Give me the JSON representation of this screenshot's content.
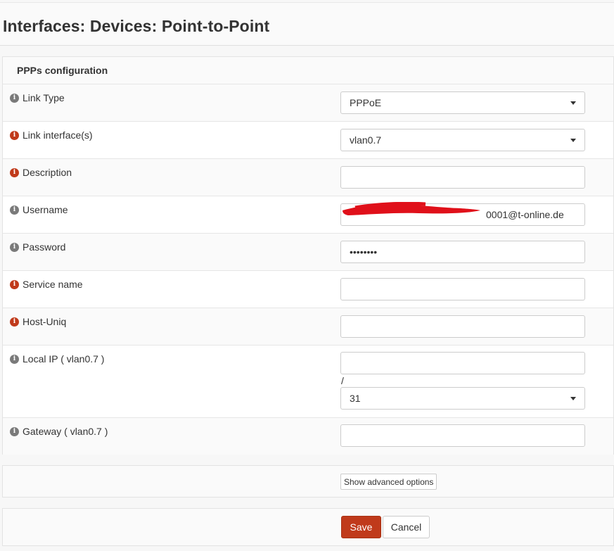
{
  "page": {
    "title": "Interfaces: Devices: Point-to-Point"
  },
  "panel": {
    "title": "PPPs configuration"
  },
  "fields": [
    {
      "label": "Link Type",
      "icon": "gray",
      "type": "select",
      "value": "PPPoE"
    },
    {
      "label": "Link interface(s)",
      "icon": "red",
      "type": "select",
      "value": "vlan0.7"
    },
    {
      "label": "Description",
      "icon": "red",
      "type": "text",
      "value": ""
    },
    {
      "label": "Username",
      "icon": "gray",
      "type": "text",
      "value": "0001@t-online.de"
    },
    {
      "label": "Password",
      "icon": "gray",
      "type": "password",
      "value": "••••••••"
    },
    {
      "label": "Service name",
      "icon": "red",
      "type": "text",
      "value": ""
    },
    {
      "label": "Host-Uniq",
      "icon": "red",
      "type": "text",
      "value": ""
    },
    {
      "label": "Local IP ( vlan0.7 )",
      "icon": "gray",
      "type": "text",
      "value": "",
      "separator": "/",
      "subnet": "31"
    },
    {
      "label": "Gateway ( vlan0.7 )",
      "icon": "gray",
      "type": "text",
      "value": ""
    }
  ],
  "buttons": {
    "advanced": "Show advanced options",
    "save": "Save",
    "cancel": "Cancel"
  },
  "colors": {
    "accent": "#c03a1b",
    "info_gray": "#7a7a7a",
    "redaction": "#e0101a"
  },
  "icons": {
    "info": "info-icon",
    "caret": "caret-down-icon"
  }
}
